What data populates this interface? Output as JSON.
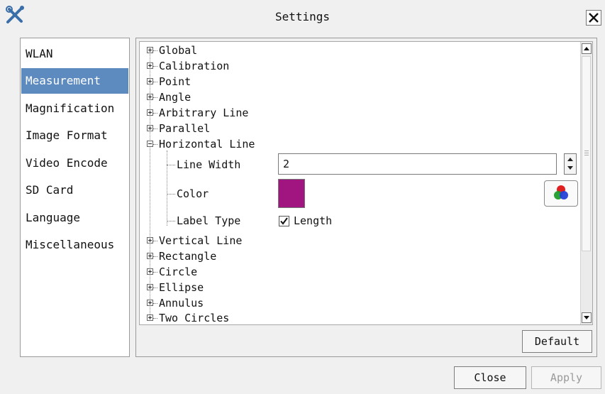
{
  "window": {
    "title": "Settings",
    "app_icon": "tools-icon",
    "close_icon": "close-icon"
  },
  "sidebar": {
    "items": [
      {
        "label": "WLAN"
      },
      {
        "label": "Measurement",
        "selected": true
      },
      {
        "label": "Magnification"
      },
      {
        "label": "Image Format"
      },
      {
        "label": "Video Encode"
      },
      {
        "label": "SD Card"
      },
      {
        "label": "Language"
      },
      {
        "label": "Miscellaneous"
      }
    ],
    "selected_color": "#5d8bbf"
  },
  "tree": {
    "nodes_before": [
      {
        "label": "Global",
        "expanded": false
      },
      {
        "label": "Calibration",
        "expanded": false
      },
      {
        "label": "Point",
        "expanded": false
      },
      {
        "label": "Angle",
        "expanded": false
      },
      {
        "label": "Arbitrary Line",
        "expanded": false
      },
      {
        "label": "Parallel",
        "expanded": false
      }
    ],
    "expanded_node": {
      "label": "Horizontal Line",
      "line_width_label": "Line Width",
      "line_width_value": "2",
      "color_label": "Color",
      "color_value": "#a0157f",
      "color_picker_icon": "rgb-circles-icon",
      "label_type_label": "Label Type",
      "length_checkbox_label": "Length",
      "length_checked": true
    },
    "nodes_after": [
      {
        "label": "Vertical Line",
        "expanded": false
      },
      {
        "label": "Rectangle",
        "expanded": false
      },
      {
        "label": "Circle",
        "expanded": false
      },
      {
        "label": "Ellipse",
        "expanded": false
      },
      {
        "label": "Annulus",
        "expanded": false
      },
      {
        "label": "Two Circles",
        "expanded": false
      }
    ]
  },
  "buttons": {
    "default": "Default",
    "close": "Close",
    "apply": "Apply",
    "apply_enabled": false
  }
}
